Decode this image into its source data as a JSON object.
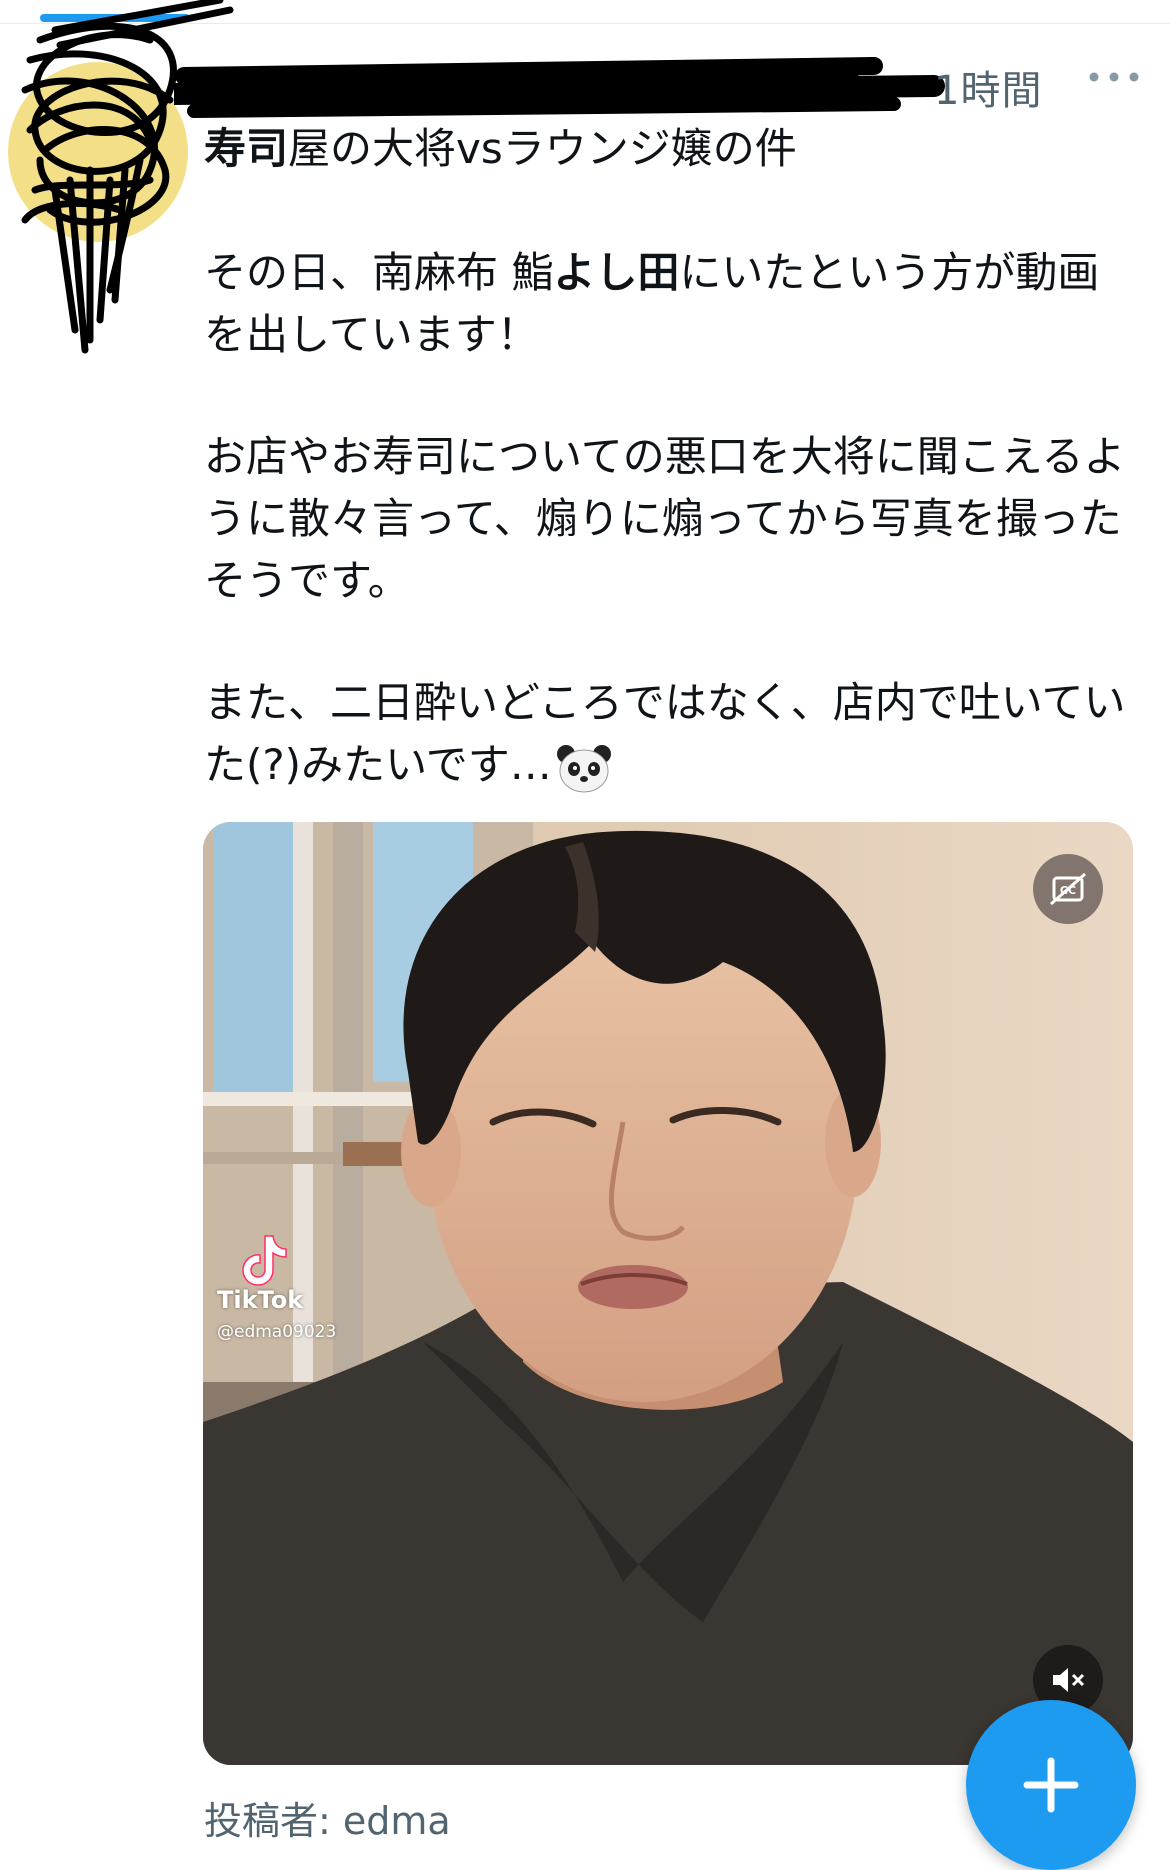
{
  "header": {
    "time": "1時間",
    "more_icon": "more-horizontal-icon"
  },
  "tweet": {
    "title_bold": "寿司",
    "title_rest": "屋の大将vsラウンジ嬢の件",
    "p1_a": "その日、南麻布 鮨",
    "p1_bold": "よし田",
    "p1_b": "にいたという方が動画を出しています！",
    "p2": "お店やお寿司についての悪口を大将に聞こえるように散々言って、煽りに煽ってから写真を撮ったそうです。",
    "p3": "また、二日酔いどころではなく、店内で吐いていた(?)みたいです…",
    "emoji": "panda-face-emoji"
  },
  "media": {
    "type": "video",
    "watermark_name": "TikTok",
    "watermark_user": "@edma09023",
    "captions_icon": "captions-off-icon",
    "mute_icon": "muted-speaker-icon"
  },
  "attribution": "投稿者: edma",
  "fab": {
    "icon": "plus-icon",
    "color": "#1d9bf0"
  },
  "colors": {
    "accent": "#1d9bf0",
    "secondary_text": "#536471"
  }
}
